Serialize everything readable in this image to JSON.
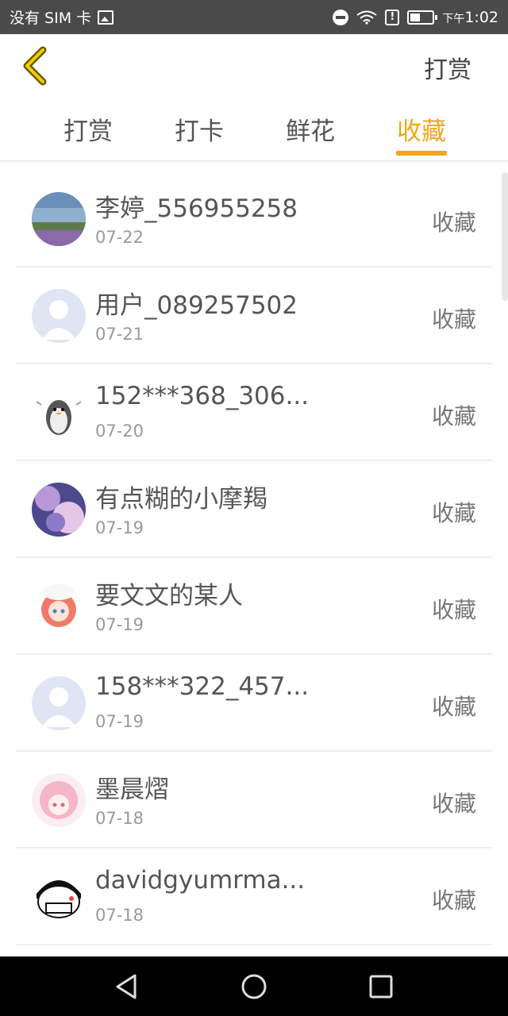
{
  "status_bar": {
    "left_text": "没有 SIM 卡",
    "time_prefix": "下午",
    "time": "1:02",
    "battery_level": 0.45
  },
  "header": {
    "title": "打赏"
  },
  "tabs": [
    {
      "label": "打赏"
    },
    {
      "label": "打卡"
    },
    {
      "label": "鲜花"
    },
    {
      "label": "收藏",
      "active": true
    }
  ],
  "list": [
    {
      "name": "李婷_556955258",
      "date": "07-22",
      "action": "收藏",
      "avatar": "landscape"
    },
    {
      "name": "用户_089257502",
      "date": "07-21",
      "action": "收藏",
      "avatar": "default"
    },
    {
      "name": "152***368_306...",
      "date": "07-20",
      "action": "收藏",
      "avatar": "penguin"
    },
    {
      "name": "有点糊的小摩羯",
      "date": "07-19",
      "action": "收藏",
      "avatar": "galaxy"
    },
    {
      "name": "要文文的某人",
      "date": "07-19",
      "action": "收藏",
      "avatar": "anime-red"
    },
    {
      "name": "158***322_457...",
      "date": "07-19",
      "action": "收藏",
      "avatar": "default"
    },
    {
      "name": "墨晨熠",
      "date": "07-18",
      "action": "收藏",
      "avatar": "anime-pink"
    },
    {
      "name": "davidgyumrma...",
      "date": "07-18",
      "action": "收藏",
      "avatar": "cartoon-face"
    }
  ],
  "colors": {
    "accent": "#f3a51c",
    "status_bar": "#4a4a4a",
    "nav_bar": "#000000"
  }
}
